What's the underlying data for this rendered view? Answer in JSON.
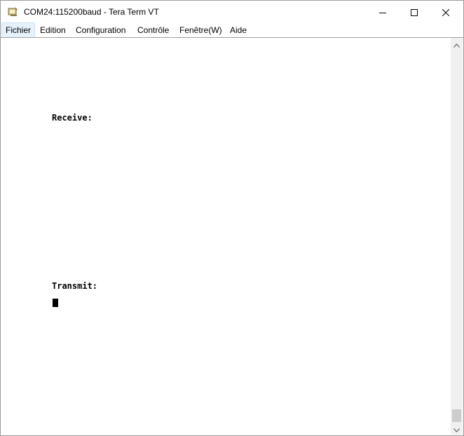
{
  "window": {
    "title": "COM24:115200baud - Tera Term VT"
  },
  "menu": {
    "items": [
      {
        "label": "Fichier"
      },
      {
        "label": "Edition"
      },
      {
        "label": "Configuration"
      },
      {
        "label": "Contrôle"
      },
      {
        "label": "Fenêtre(W)"
      },
      {
        "label": "Aide"
      }
    ],
    "active_index": 0
  },
  "terminal": {
    "receive_label": "Receive:",
    "transmit_label": "Transmit:"
  },
  "icons": {
    "app": "teraterm-icon",
    "minimize": "minimize-icon",
    "maximize": "maximize-icon",
    "close": "close-icon",
    "scroll_up": "chevron-up-icon",
    "scroll_down": "chevron-down-icon"
  }
}
